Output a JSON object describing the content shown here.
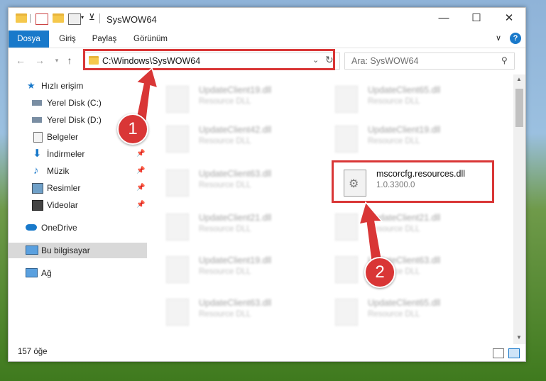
{
  "window": {
    "title": "SysWOW64",
    "controls": {
      "minimize": "—",
      "maximize": "☐",
      "close": "✕"
    }
  },
  "ribbon": {
    "tabs": [
      "Dosya",
      "Giriş",
      "Paylaş",
      "Görünüm"
    ],
    "help_icon": "?",
    "expand_icon": "∨"
  },
  "address": {
    "path": "C:\\Windows\\SysWOW64",
    "search_placeholder": "Ara: SysWOW64"
  },
  "nav": {
    "items": [
      {
        "label": "Hızlı erişim",
        "icon": "star-icon",
        "pinned": false
      },
      {
        "label": "Yerel Disk (C:)",
        "icon": "drive-icon",
        "pinned": false
      },
      {
        "label": "Yerel Disk (D:)",
        "icon": "drive-icon",
        "pinned": false
      },
      {
        "label": "Belgeler",
        "icon": "document-icon",
        "pinned": false
      },
      {
        "label": "İndirmeler",
        "icon": "download-icon",
        "pinned": true
      },
      {
        "label": "Müzik",
        "icon": "music-icon",
        "pinned": true
      },
      {
        "label": "Resimler",
        "icon": "pictures-icon",
        "pinned": true
      },
      {
        "label": "Videolar",
        "icon": "video-icon",
        "pinned": true
      },
      {
        "label": "OneDrive",
        "icon": "cloud-icon",
        "pinned": false
      },
      {
        "label": "Bu bilgisayar",
        "icon": "computer-icon",
        "pinned": false,
        "selected": true
      },
      {
        "label": "Ağ",
        "icon": "network-icon",
        "pinned": false
      }
    ]
  },
  "files": {
    "left": [
      {
        "name": "UpdateClient19.dll",
        "desc": "Resource DLL"
      },
      {
        "name": "UpdateClient42.dll",
        "desc": "Resource DLL"
      },
      {
        "name": "UpdateClient63.dll",
        "desc": "Resource DLL"
      },
      {
        "name": "UpdateClient21.dll",
        "desc": "Resource DLL"
      },
      {
        "name": "UpdateClient19.dll",
        "desc": "Resource DLL"
      },
      {
        "name": "UpdateClient63.dll",
        "desc": "Resource DLL"
      }
    ],
    "right": [
      {
        "name": "UpdateClient65.dll",
        "desc": "Resource DLL"
      },
      {
        "name": "UpdateClient19.dll",
        "desc": "Resource DLL"
      },
      {
        "name": "mscorcfg.resources.dll",
        "desc": "1.0.3300.0",
        "highlighted": true
      },
      {
        "name": "UpdateClient21.dll",
        "desc": "Resource DLL"
      },
      {
        "name": "UpdateClient63.dll",
        "desc": "Resource DLL"
      },
      {
        "name": "UpdateClient65.dll",
        "desc": "Resource DLL"
      }
    ]
  },
  "status": {
    "item_count": "157 öğe"
  },
  "annotations": {
    "step1": "1",
    "step2": "2",
    "color": "#d93636"
  }
}
